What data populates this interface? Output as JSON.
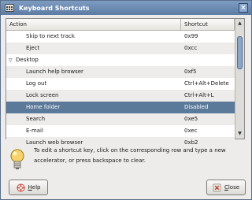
{
  "window": {
    "title": "Keyboard Shortcuts",
    "close_glyph": "×"
  },
  "table": {
    "headers": {
      "action": "Action",
      "shortcut": "Shortcut"
    },
    "rows": [
      {
        "action": "Skip to next track",
        "shortcut": "0x99",
        "kind": "child"
      },
      {
        "action": "Eject",
        "shortcut": "0xcc",
        "kind": "child"
      },
      {
        "action": "Desktop",
        "shortcut": "",
        "kind": "group",
        "expanded": true
      },
      {
        "action": "Launch help browser",
        "shortcut": "0xf5",
        "kind": "child"
      },
      {
        "action": "Log out",
        "shortcut": "Ctrl+Alt+Delete",
        "kind": "child"
      },
      {
        "action": "Lock screen",
        "shortcut": "Ctrl+Alt+L",
        "kind": "child"
      },
      {
        "action": "Home folder",
        "shortcut": "Disabled",
        "kind": "child",
        "selected": true
      },
      {
        "action": "Search",
        "shortcut": "0xe5",
        "kind": "child"
      },
      {
        "action": "E-mail",
        "shortcut": "0xec",
        "kind": "child"
      },
      {
        "action": "Launch web browser",
        "shortcut": "0xb2",
        "kind": "child"
      }
    ]
  },
  "hint": {
    "text": "To edit a shortcut key, click on the corresponding row and type a new accelerator, or press backspace to clear.",
    "icon": "lightbulb-icon"
  },
  "buttons": {
    "help": {
      "accel": "H",
      "rest": "elp",
      "icon": "lifebuoy-icon"
    },
    "close": {
      "accel": "C",
      "rest": "lose",
      "icon": "close-icon"
    }
  },
  "colors": {
    "titlebar": "#6f8db3",
    "selection": "#5b7999"
  }
}
